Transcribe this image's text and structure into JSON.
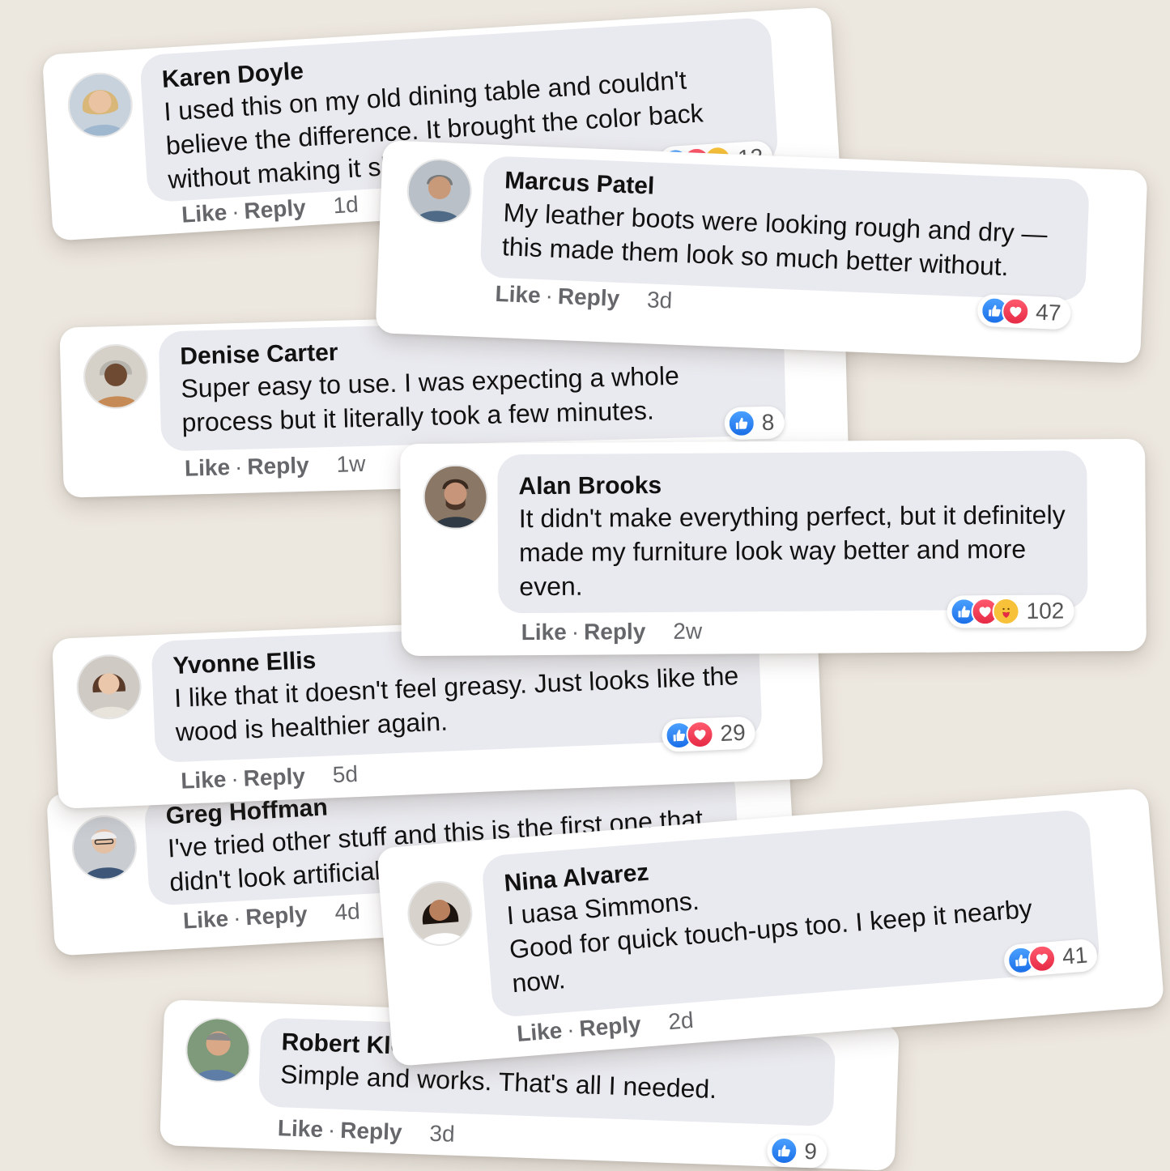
{
  "colors": {
    "background": "#ece7df",
    "card": "#ffffff",
    "bubble": "#e9eaef",
    "like_blue": "#1b6fe8",
    "love_red": "#e62a45",
    "care_yellow": "#f7c23a",
    "meta_gray": "#65676b"
  },
  "comments": [
    {
      "author": "Karen Doyle",
      "text": "I used this on my old dining table and couldn't believe the difference. It brought the color back without making it shiny.",
      "reactions": [
        "like",
        "love",
        "care"
      ],
      "reaction_count": "12",
      "like_label": "Like",
      "separator": "·",
      "reply_label": "Reply",
      "time": "1d"
    },
    {
      "author": "Marcus Patel",
      "text": "My leather boots were looking rough and dry — this made them look so much better without.",
      "reactions": [
        "like",
        "love"
      ],
      "reaction_count": "47",
      "like_label": "Like",
      "separator": "·",
      "reply_label": "Reply",
      "time": "3d"
    },
    {
      "author": "Denise Carter",
      "text": "Super easy to use. I was expecting a whole process but it literally took a few minutes.",
      "reactions": [
        "like"
      ],
      "reaction_count": "8",
      "like_label": "Like",
      "separator": "·",
      "reply_label": "Reply",
      "time": "1w"
    },
    {
      "author": "Alan Brooks",
      "text": "It didn't make everything perfect, but it definitely made my furniture look way better and more even.",
      "reactions": [
        "like",
        "love",
        "care"
      ],
      "reaction_count": "102",
      "like_label": "Like",
      "separator": "·",
      "reply_label": "Reply",
      "time": "2w"
    },
    {
      "author": "Yvonne Ellis",
      "text": "I like that it doesn't feel greasy. Just looks like the wood is healthier again.",
      "reactions": [
        "like",
        "love"
      ],
      "reaction_count": "29",
      "like_label": "Like",
      "separator": "·",
      "reply_label": "Reply",
      "time": "5d"
    },
    {
      "author": "Greg Hoffman",
      "text": "I've tried other stuff and this is the first one that didn't look artificial.",
      "like_label": "Like",
      "separator": "·",
      "reply_label": "Reply",
      "time": "4d"
    },
    {
      "author": "Nina Alvarez",
      "text": "I uasa Simmons.\nGood for quick touch-ups too. I keep it nearby now.",
      "reactions": [
        "like",
        "love"
      ],
      "reaction_count": "41",
      "like_label": "Like",
      "separator": "·",
      "reply_label": "Reply",
      "time": "2d"
    },
    {
      "author": "Robert Kle",
      "text": "Simple and works. That's all I needed.",
      "reactions": [
        "like"
      ],
      "reaction_count": "9",
      "like_label": "Like",
      "separator": "·",
      "reply_label": "Reply",
      "time": "3d"
    }
  ]
}
